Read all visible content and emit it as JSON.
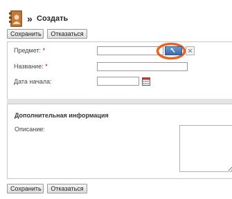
{
  "header": {
    "breadcrumb_sep": "»",
    "title": "Создать",
    "logo_icon": "address-book-icon"
  },
  "toolbar_top": {
    "save_label": "Сохранить",
    "cancel_label": "Отказаться"
  },
  "form": {
    "subject": {
      "label": "Предмет:",
      "required_mark": "*",
      "value": "",
      "lookup_icon": "lookup-icon",
      "clear_icon": "clear-icon"
    },
    "name": {
      "label": "Название:",
      "required_mark": "*",
      "value": ""
    },
    "start_date": {
      "label": "Дата начала:",
      "value": "",
      "calendar_icon": "calendar-icon"
    }
  },
  "additional": {
    "title": "Дополнительная информация",
    "description_label": "Описание:",
    "description_value": ""
  },
  "toolbar_bottom": {
    "save_label": "Сохранить",
    "cancel_label": "Отказаться"
  },
  "colors": {
    "highlight_ring": "#e8641e",
    "lookup_button": "#4a78b8",
    "required": "#cc0000"
  }
}
